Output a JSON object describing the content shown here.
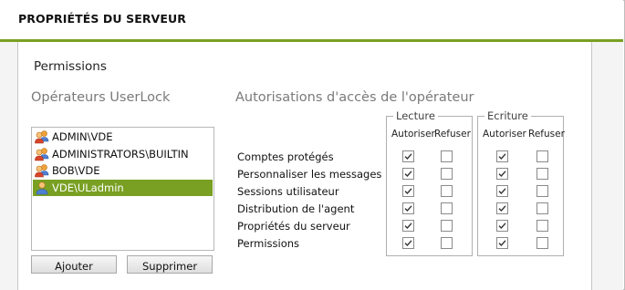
{
  "header": {
    "title": "PROPRIÉTÉS DU SERVEUR"
  },
  "panel": {
    "title": "Permissions"
  },
  "operators": {
    "section_title": "Opérateurs UserLock",
    "items": [
      {
        "label": "ADMIN\\VDE",
        "type": "group",
        "selected": false
      },
      {
        "label": "ADMINISTRATORS\\BUILTIN",
        "type": "group",
        "selected": false
      },
      {
        "label": "BOB\\VDE",
        "type": "group",
        "selected": false
      },
      {
        "label": "VDE\\ULadmin",
        "type": "user",
        "selected": true
      }
    ],
    "add_label": "Ajouter",
    "remove_label": "Supprimer"
  },
  "authorizations": {
    "section_title": "Autorisations d'accès de l'opérateur",
    "groups": [
      {
        "name": "Lecture",
        "columns": [
          "Autoriser",
          "Refuser"
        ]
      },
      {
        "name": "Ecriture",
        "columns": [
          "Autoriser",
          "Refuser"
        ]
      }
    ],
    "rows": [
      {
        "label": "Comptes protégés",
        "read_allow": true,
        "read_deny": false,
        "write_allow": true,
        "write_deny": false
      },
      {
        "label": "Personnaliser les messages",
        "read_allow": true,
        "read_deny": false,
        "write_allow": true,
        "write_deny": false
      },
      {
        "label": "Sessions utilisateur",
        "read_allow": true,
        "read_deny": false,
        "write_allow": true,
        "write_deny": false
      },
      {
        "label": "Distribution de l'agent",
        "read_allow": true,
        "read_deny": false,
        "write_allow": true,
        "write_deny": false
      },
      {
        "label": "Propriétés du serveur",
        "read_allow": true,
        "read_deny": false,
        "write_allow": true,
        "write_deny": false
      },
      {
        "label": "Permissions",
        "read_allow": true,
        "read_deny": false,
        "write_allow": true,
        "write_deny": false
      }
    ]
  },
  "colors": {
    "accent": "#79a023",
    "section_text": "#7a7a7a"
  }
}
